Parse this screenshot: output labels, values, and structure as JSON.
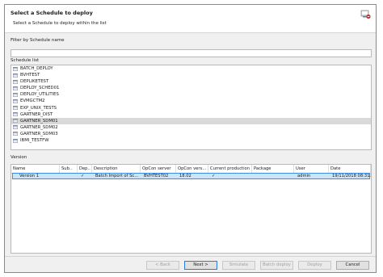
{
  "dialog": {
    "title": "Select a Schedule to deploy",
    "subtitle": "Select a Schedule to deploy within the list",
    "icon": "deploy-wizard-icon"
  },
  "filter": {
    "label": "Filter by Schedule name",
    "value": ""
  },
  "schedule_list": {
    "label": "Schedule list",
    "items": [
      {
        "name": "BATCH_DEPLOY"
      },
      {
        "name": "BVHTEST"
      },
      {
        "name": "DEPLIKETEST"
      },
      {
        "name": "DEPLOY_SCHED01"
      },
      {
        "name": "DEPLOY_UTILITIES"
      },
      {
        "name": "EVMGCTM2"
      },
      {
        "name": "EXP_UNIX_TESTS"
      },
      {
        "name": "GARTNER_DIST"
      },
      {
        "name": "GARTNER_SDM01"
      },
      {
        "name": "GARTNER_SDM02"
      },
      {
        "name": "GARTNER_SDM03"
      },
      {
        "name": "IBMI_TESTFW"
      }
    ],
    "selected_index": 8
  },
  "version": {
    "label": "Version",
    "columns": [
      "Name",
      "Sub..",
      "Dep..",
      "Description",
      "OpCon server",
      "OpCon vers...",
      "Current production",
      "Package",
      "User",
      "Date"
    ],
    "rows": [
      {
        "name": "Version 1",
        "sub": "",
        "dep": "✓",
        "description": "Batch Import of Sc...",
        "opcon_server": "BVHTEST02",
        "opcon_version": "18.02",
        "current_production": "✓",
        "package": "",
        "user": "admin",
        "date": "19/11/2018 08:31:997"
      }
    ]
  },
  "buttons": {
    "back": "< Back",
    "next": "Next >",
    "simulate": "Simulate",
    "batch_deploy": "Batch deploy",
    "deploy": "Deploy",
    "cancel": "Cancel"
  },
  "colors": {
    "selection": "#cce4f7",
    "selection_border": "#3d8ee0",
    "list_selected": "#d9d9d9"
  }
}
